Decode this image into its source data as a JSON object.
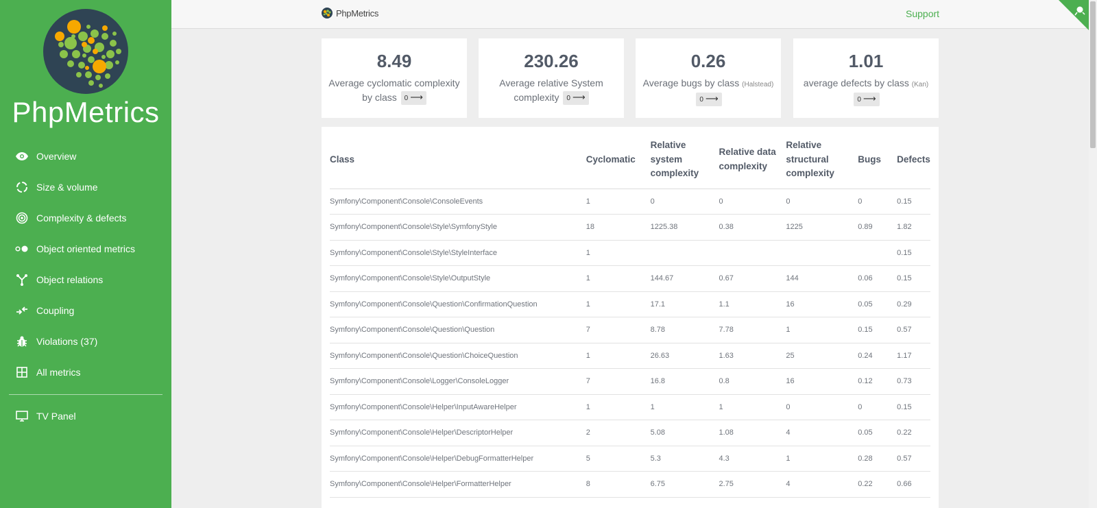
{
  "sidebar": {
    "brand": "PhpMetrics",
    "items": [
      {
        "label": "Overview",
        "icon": "eye-icon"
      },
      {
        "label": "Size & volume",
        "icon": "circle-notch-icon"
      },
      {
        "label": "Complexity & defects",
        "icon": "target-icon"
      },
      {
        "label": "Object oriented metrics",
        "icon": "dots-icon"
      },
      {
        "label": "Object relations",
        "icon": "relations-icon"
      },
      {
        "label": "Coupling",
        "icon": "coupling-icon"
      },
      {
        "label": "Violations (37)",
        "icon": "bug-icon"
      },
      {
        "label": "All metrics",
        "icon": "grid-icon"
      }
    ],
    "tv_panel": {
      "label": "TV Panel",
      "icon": "monitor-icon"
    }
  },
  "topbar": {
    "brand": "PhpMetrics",
    "support": "Support"
  },
  "cards": [
    {
      "value": "8.49",
      "label": "Average cyclomatic complexity by class",
      "note": "",
      "badge": "0"
    },
    {
      "value": "230.26",
      "label": "Average relative System complexity",
      "note": "",
      "badge": "0"
    },
    {
      "value": "0.26",
      "label": "Average bugs by class",
      "note": "(Halstead)",
      "badge": "0"
    },
    {
      "value": "1.01",
      "label": "average defects by class",
      "note": "(Kan)",
      "badge": "0"
    }
  ],
  "table": {
    "headers": [
      "Class",
      "Cyclomatic",
      "Relative system complexity",
      "Relative data complexity",
      "Relative structural complexity",
      "Bugs",
      "Defects"
    ],
    "rows": [
      [
        "Symfony\\Component\\Console\\ConsoleEvents",
        "1",
        "0",
        "0",
        "0",
        "0",
        "0.15"
      ],
      [
        "Symfony\\Component\\Console\\Style\\SymfonyStyle",
        "18",
        "1225.38",
        "0.38",
        "1225",
        "0.89",
        "1.82"
      ],
      [
        "Symfony\\Component\\Console\\Style\\StyleInterface",
        "1",
        "",
        "",
        "",
        "",
        "0.15"
      ],
      [
        "Symfony\\Component\\Console\\Style\\OutputStyle",
        "1",
        "144.67",
        "0.67",
        "144",
        "0.06",
        "0.15"
      ],
      [
        "Symfony\\Component\\Console\\Question\\ConfirmationQuestion",
        "1",
        "17.1",
        "1.1",
        "16",
        "0.05",
        "0.29"
      ],
      [
        "Symfony\\Component\\Console\\Question\\Question",
        "7",
        "8.78",
        "7.78",
        "1",
        "0.15",
        "0.57"
      ],
      [
        "Symfony\\Component\\Console\\Question\\ChoiceQuestion",
        "1",
        "26.63",
        "1.63",
        "25",
        "0.24",
        "1.17"
      ],
      [
        "Symfony\\Component\\Console\\Logger\\ConsoleLogger",
        "7",
        "16.8",
        "0.8",
        "16",
        "0.12",
        "0.73"
      ],
      [
        "Symfony\\Component\\Console\\Helper\\InputAwareHelper",
        "1",
        "1",
        "1",
        "0",
        "0",
        "0.15"
      ],
      [
        "Symfony\\Component\\Console\\Helper\\DescriptorHelper",
        "2",
        "5.08",
        "1.08",
        "4",
        "0.05",
        "0.22"
      ],
      [
        "Symfony\\Component\\Console\\Helper\\DebugFormatterHelper",
        "5",
        "5.3",
        "4.3",
        "1",
        "0.28",
        "0.57"
      ],
      [
        "Symfony\\Component\\Console\\Helper\\FormatterHelper",
        "8",
        "6.75",
        "2.75",
        "4",
        "0.22",
        "0.66"
      ]
    ]
  },
  "colors": {
    "accent": "#4caf50",
    "logo_bg": "#2f4454",
    "bubble_orange": "#f7a800",
    "bubble_green": "#8bc34a"
  }
}
